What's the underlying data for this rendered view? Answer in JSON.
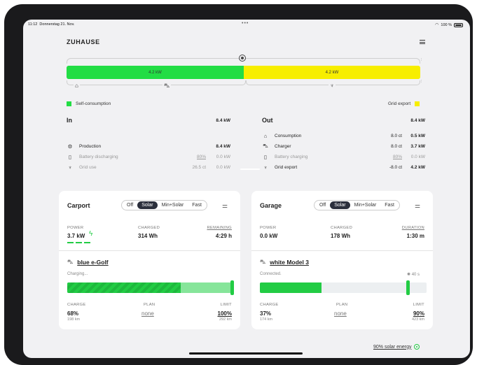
{
  "status_bar": {
    "time": "11:12",
    "date": "Donnerstag 21. Nov.",
    "battery": "100 %"
  },
  "header": {
    "title": "ZUHAUSE"
  },
  "flow": {
    "self_consumption_power": "4.2 kW",
    "grid_export_power": "4.2 kW",
    "self_fraction": 0.5
  },
  "legend": {
    "self_consumption": "Self-consumption",
    "grid_export": "Grid export"
  },
  "colors": {
    "self": "#22dd44",
    "export": "#f7ee00",
    "accent": "#22cc44",
    "dark": "#2b2f3c"
  },
  "in": {
    "title": "In",
    "total": "8.4 kW",
    "rows": [
      {
        "icon": "sun-icon",
        "label": "Production",
        "mid": "",
        "value": "8.4 kW",
        "dim": false
      },
      {
        "icon": "battery-icon",
        "label": "Battery discharging",
        "mid": "80%",
        "value": "0.0 kW",
        "dim": true
      },
      {
        "icon": "grid-tower-icon",
        "label": "Grid use",
        "mid": "26.5 ct",
        "value": "0.0 kW",
        "dim": true
      }
    ]
  },
  "out": {
    "title": "Out",
    "total": "8.4 kW",
    "rows": [
      {
        "icon": "home-icon",
        "label": "Consumption",
        "mid": "8.0 ct",
        "value": "0.5 kW",
        "dim": false
      },
      {
        "icon": "car-icon",
        "label": "Charger",
        "mid": "8.0 ct",
        "value": "3.7 kW",
        "dim": false
      },
      {
        "icon": "battery-icon",
        "label": "Battery charging",
        "mid": "80%",
        "value": "0.0 kW",
        "dim": true
      },
      {
        "icon": "grid-tower-icon",
        "label": "Grid export",
        "mid": "-8.0 ct",
        "value": "4.2 kW",
        "dim": false
      }
    ]
  },
  "cards": [
    {
      "title": "Carport",
      "modes": [
        "Off",
        "Solar",
        "Min+Solar",
        "Fast"
      ],
      "active_mode": "Solar",
      "power_label": "POWER",
      "power": "3.7 kW",
      "charged_label": "CHARGED",
      "charged": "314 Wh",
      "time_label": "REMAINING",
      "time": "4:29 h",
      "vehicle": "blue e-Golf",
      "status": "Charging...",
      "timer": "",
      "soc_fraction": 0.68,
      "limit_fraction": 1.0,
      "charge_label": "CHARGE",
      "charge": "68%",
      "range": "198 km",
      "plan_label": "PLAN",
      "plan": "none",
      "limit_label": "LIMIT",
      "limit": "100%",
      "limit_range": "292 km"
    },
    {
      "title": "Garage",
      "modes": [
        "Off",
        "Solar",
        "Min+Solar",
        "Fast"
      ],
      "active_mode": "Solar",
      "power_label": "POWER",
      "power": "0.0 kW",
      "charged_label": "CHARGED",
      "charged": "178 Wh",
      "time_label": "DURATION",
      "time": "1:30 m",
      "vehicle": "white Model 3",
      "status": "Connected.",
      "timer": "40 s",
      "soc_fraction": 0.37,
      "limit_fraction": 0.9,
      "charge_label": "CHARGE",
      "charge": "37%",
      "range": "174 km",
      "plan_label": "PLAN",
      "plan": "none",
      "limit_label": "LIMIT",
      "limit": "90%",
      "limit_range": "423 km"
    }
  ],
  "footer": {
    "solar_energy": "90% solar energy"
  }
}
